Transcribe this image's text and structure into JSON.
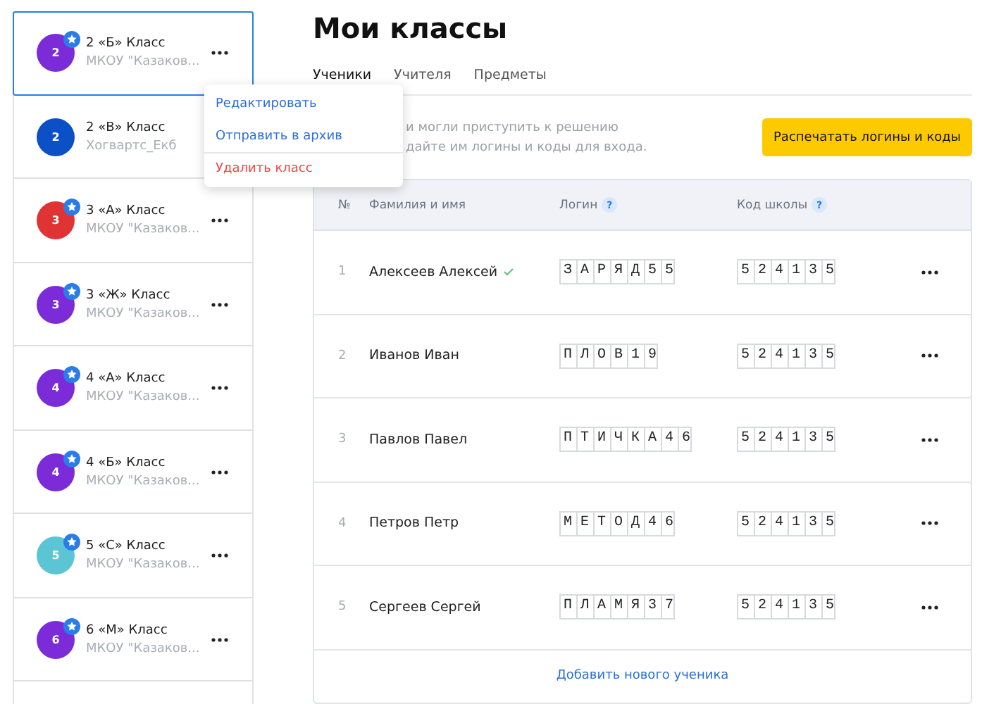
{
  "classes": [
    {
      "title": "2 «Б» Класс",
      "school": "МКОУ \"Казаков...",
      "avatar": "2",
      "color": "#7b2bd8",
      "starred": true,
      "selected": true
    },
    {
      "title": "2 «В» Класс",
      "school": "Хогвартс_Екб",
      "avatar": "2",
      "color": "#0c50c8",
      "starred": false,
      "selected": false
    },
    {
      "title": "3 «А» Класс",
      "school": "МКОУ \"Казаков...",
      "avatar": "3",
      "color": "#e03434",
      "starred": true,
      "selected": false
    },
    {
      "title": "3 «Ж» Класс",
      "school": "МКОУ \"Казаков...",
      "avatar": "3",
      "color": "#7b2bd8",
      "starred": true,
      "selected": false
    },
    {
      "title": "4 «А» Класс",
      "school": "МКОУ \"Казаков...",
      "avatar": "4",
      "color": "#7b2bd8",
      "starred": true,
      "selected": false
    },
    {
      "title": "4 «Б» Класс",
      "school": "МКОУ \"Казаков...",
      "avatar": "4",
      "color": "#7b2bd8",
      "starred": true,
      "selected": false
    },
    {
      "title": "5 «С» Класс",
      "school": "МКОУ \"Казаков...",
      "avatar": "5",
      "color": "#5bc5d3",
      "starred": true,
      "selected": false
    },
    {
      "title": "6 «М» Класс",
      "school": "МКОУ \"Казаков...",
      "avatar": "6",
      "color": "#7b2bd8",
      "starred": true,
      "selected": false
    }
  ],
  "context_menu": [
    {
      "label": "Редактировать",
      "kind": "normal"
    },
    {
      "label": "Отправить в архив",
      "kind": "normal"
    },
    {
      "label": "Удалить класс",
      "kind": "danger"
    }
  ],
  "title": "Мои классы",
  "tabs": [
    {
      "label": "Ученики",
      "selected": true
    },
    {
      "label": "Учителя",
      "selected": false
    },
    {
      "label": "Предметы",
      "selected": false
    }
  ],
  "hint_lines": [
    "и могли приступить к решению",
    "дайте им логины и коды для входа."
  ],
  "print_button": "Распечатать логины и коды",
  "table": {
    "columns": [
      {
        "label": "№"
      },
      {
        "label": "Фамилия и имя"
      },
      {
        "label": "Логин",
        "help": "?"
      },
      {
        "label": "Код школы",
        "help": "?"
      }
    ],
    "rows": [
      {
        "num": "1",
        "name": "Алексеев Алексей",
        "verified": true,
        "login": "З А Р Я Д 5 5",
        "school_code": "5 2 4 1 3 5"
      },
      {
        "num": "2",
        "name": "Иванов Иван",
        "verified": false,
        "login": "П Л О В 1 9",
        "school_code": "5 2 4 1 3 5"
      },
      {
        "num": "3",
        "name": "Павлов Павел",
        "verified": false,
        "login": "П Т И Ч К А 4 6",
        "school_code": "5 2 4 1 3 5"
      },
      {
        "num": "4",
        "name": "Петров Петр",
        "verified": false,
        "login": "М Е Т О Д 4 6",
        "school_code": "5 2 4 1 3 5"
      },
      {
        "num": "5",
        "name": "Сергеев Сергей",
        "verified": false,
        "login": "П Л А М Я 3 7",
        "school_code": "5 2 4 1 3 5"
      }
    ],
    "add_link": "Добавить нового ученика"
  }
}
